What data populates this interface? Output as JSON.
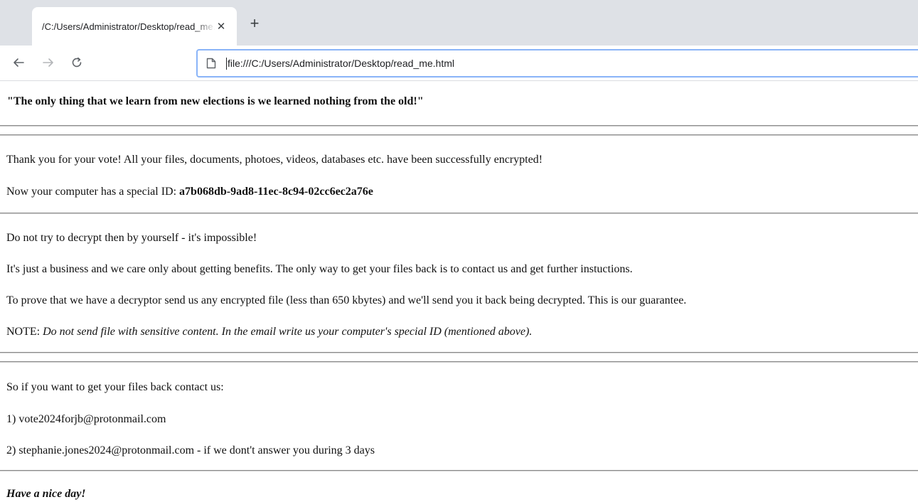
{
  "browser": {
    "tab": {
      "title": "/C:/Users/Administrator/Desktop/read_me.html",
      "close_icon": "close-icon"
    },
    "new_tab_icon": "plus-icon",
    "nav": {
      "back_icon": "arrow-left-icon",
      "forward_icon": "arrow-right-icon",
      "reload_icon": "reload-icon"
    },
    "address_bar": {
      "value": "file:///C:/Users/Administrator/Desktop/read_me.html",
      "icon": "page-icon"
    }
  },
  "page": {
    "heading": "\"The only thing that we learn from new elections is we learned nothing from the old!\"",
    "thank_you": "Thank you for your vote! All your files, documents, photoes, videos, databases etc. have been successfully encrypted!",
    "special_id_label": "Now your computer has a special ID: ",
    "special_id": "a7b068db-9ad8-11ec-8c94-02cc6ec2a76e",
    "no_decrypt": "Do not try to decrypt then by yourself - it's impossible!",
    "business": "It's just a business and we care only about getting benefits. The only way to get your files back is to contact us and get further instuctions.",
    "prove": "To prove that we have a decryptor send us any encrypted file (less than 650 kbytes) and we'll send you it back being decrypted. This is our guarantee.",
    "note_label": "NOTE: ",
    "note_text": "Do not send file with sensitive content. In the email write us your computer's special ID (mentioned above).",
    "contact_intro": "So if you want to get your files back contact us:",
    "contact_1": "1) vote2024forjb@protonmail.com",
    "contact_2": "2) stephanie.jones2024@protonmail.com - if we dont't answer you during 3 days",
    "sign_off": "Have a nice day!"
  }
}
